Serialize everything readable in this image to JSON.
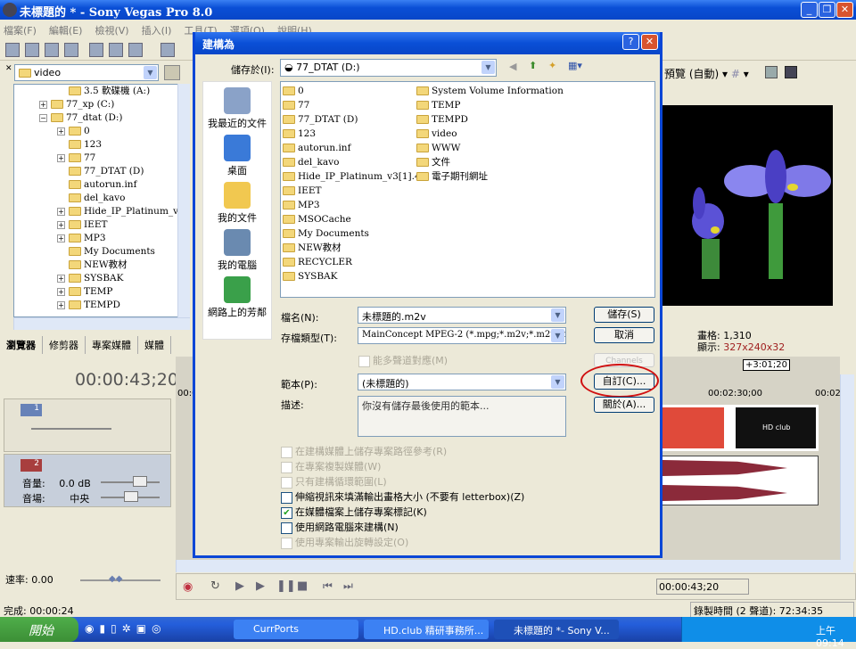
{
  "app": {
    "title": "未標題的 * - Sony Vegas Pro 8.0",
    "menu": [
      "檔案(F)",
      "編輯(E)",
      "檢視(V)",
      "插入(I)",
      "工具(T)",
      "選項(O)",
      "說明(H)"
    ]
  },
  "explorer": {
    "path": "video",
    "tree": [
      {
        "label": "3.5 軟碟機 (A:)",
        "indent": 2,
        "exp": ""
      },
      {
        "label": "77_xp (C:)",
        "indent": 1,
        "exp": "+"
      },
      {
        "label": "77_dtat (D:)",
        "indent": 1,
        "exp": "−"
      },
      {
        "label": "0",
        "indent": 2,
        "exp": "+"
      },
      {
        "label": "123",
        "indent": 2,
        "exp": ""
      },
      {
        "label": "77",
        "indent": 2,
        "exp": "+"
      },
      {
        "label": "77_DTAT (D)",
        "indent": 2,
        "exp": ""
      },
      {
        "label": "autorun.inf",
        "indent": 2,
        "exp": ""
      },
      {
        "label": "del_kavo",
        "indent": 2,
        "exp": ""
      },
      {
        "label": "Hide_IP_Platinum_v3[1",
        "indent": 2,
        "exp": "+"
      },
      {
        "label": "IEET",
        "indent": 2,
        "exp": "+"
      },
      {
        "label": "MP3",
        "indent": 2,
        "exp": "+"
      },
      {
        "label": "My Documents",
        "indent": 2,
        "exp": ""
      },
      {
        "label": "NEW教材",
        "indent": 2,
        "exp": ""
      },
      {
        "label": "SYSBAK",
        "indent": 2,
        "exp": "+"
      },
      {
        "label": "TEMP",
        "indent": 2,
        "exp": "+"
      },
      {
        "label": "TEMPD",
        "indent": 2,
        "exp": "+"
      }
    ],
    "tabs": [
      "瀏覽器",
      "修剪器",
      "專案媒體",
      "媒體"
    ]
  },
  "preview": {
    "mode": "預覽 (自動)",
    "frame_label": "畫格:",
    "frame": "1,310",
    "display_label": "顯示:",
    "display": "327x240x32"
  },
  "timeline": {
    "time": "00:00:43;20",
    "ruler": [
      "00:00",
      "00:02:30;00",
      "00:02"
    ],
    "region": "+3:01;20",
    "track2": {
      "volume_label": "音量:",
      "volume": "0.0 dB",
      "pan_label": "音場:",
      "pan": "中央"
    },
    "rate_label": "速率: 0.00",
    "transport_time": "00:00:43;20",
    "done": "完成: 00:00:24",
    "record": "錄製時間 (2 聲道): 72:34:35"
  },
  "dialog": {
    "title": "建構為",
    "save_in_label": "儲存於(I):",
    "save_in": "77_DTAT (D:)",
    "places": [
      "我最近的文件",
      "桌面",
      "我的文件",
      "我的電腦",
      "網路上的芳鄰"
    ],
    "files_col1": [
      "0",
      "77",
      "77_DTAT (D)",
      "123",
      "autorun.inf",
      "del_kavo",
      "Hide_IP_Platinum_v3[1].42",
      "IEET",
      "MP3",
      "MSOCache",
      "My Documents",
      "NEW教材",
      "RECYCLER",
      "SYSBAK"
    ],
    "files_col2": [
      "System Volume Information",
      "TEMP",
      "TEMPD",
      "video",
      "WWW",
      "文件",
      "電子期刊網址"
    ],
    "filename_label": "檔名(N):",
    "filename": "未標題的.m2v",
    "filetype_label": "存檔類型(T):",
    "filetype": "MainConcept MPEG-2 (*.mpg;*.m2v;*.m2t;*.r",
    "multichannel": "能多聲道對應(M)",
    "template_label": "範本(P):",
    "template": "(未標題的)",
    "desc_label": "描述:",
    "desc": "你沒有儲存最後使用的範本...",
    "buttons": {
      "save": "儲存(S)",
      "cancel": "取消",
      "disabled": "Channels",
      "custom": "自訂(C)...",
      "about": "關於(A)..."
    },
    "checks": [
      {
        "label": "在建構媒體上儲存專案路徑參考(R)",
        "checked": false,
        "disabled": true
      },
      {
        "label": "在專案複製媒體(W)",
        "checked": false,
        "disabled": true
      },
      {
        "label": "只有建構循環範圍(L)",
        "checked": false,
        "disabled": true
      },
      {
        "label": "伸縮視訊來填滿輸出畫格大小 (不要有 letterbox)(Z)",
        "checked": false,
        "disabled": false
      },
      {
        "label": "在媒體檔案上儲存專案標記(K)",
        "checked": true,
        "disabled": false
      },
      {
        "label": "使用網路電腦來建構(N)",
        "checked": false,
        "disabled": false
      },
      {
        "label": "使用專案輸出旋轉設定(O)",
        "checked": false,
        "disabled": true
      }
    ],
    "highlight_color": "#d01010"
  },
  "taskbar": {
    "start": "開始",
    "tasks": [
      "CurrPorts",
      "HD.club 精研事務所...",
      "未標題的 *- Sony V..."
    ],
    "clock": "上午 09:14"
  }
}
